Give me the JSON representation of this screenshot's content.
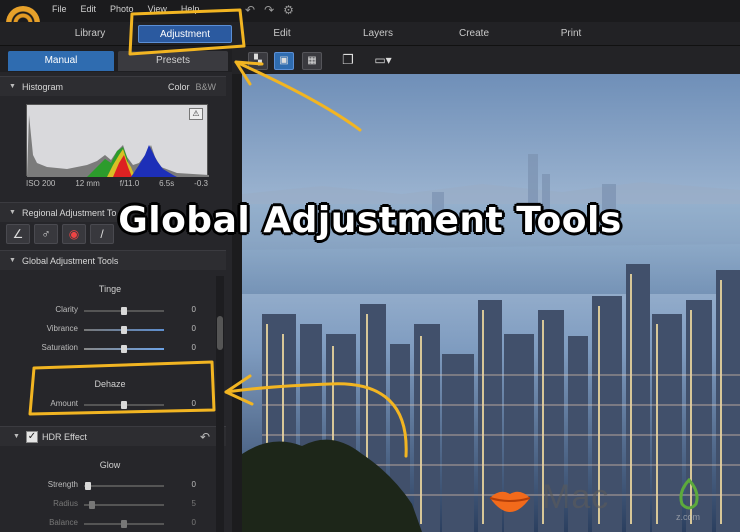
{
  "menu": [
    "File",
    "Edit",
    "Photo",
    "View",
    "Help"
  ],
  "modes": {
    "library": "Library",
    "adjustment": "Adjustment",
    "edit": "Edit",
    "layers": "Layers",
    "create": "Create",
    "print": "Print"
  },
  "panel_tabs": {
    "manual": "Manual",
    "presets": "Presets"
  },
  "histogram": {
    "title": "Histogram",
    "color": "Color",
    "bw": "B&W",
    "info": [
      "ISO 200",
      "12 mm",
      "f/11.0",
      "6.5s",
      "-0.3"
    ]
  },
  "regional": {
    "title": "Regional Adjustment To"
  },
  "global": {
    "title": "Global Adjustment Tools",
    "tinge": {
      "label": "Tinge",
      "rows": [
        {
          "label": "Clarity",
          "value": "0",
          "level": 0.5
        },
        {
          "label": "Vibrance",
          "value": "0",
          "level": 0.5
        },
        {
          "label": "Saturation",
          "value": "0",
          "level": 0.5
        }
      ]
    },
    "dehaze": {
      "label": "Dehaze",
      "rows": [
        {
          "label": "Amount",
          "value": "0",
          "level": 0.5
        }
      ]
    }
  },
  "hdr": {
    "title": "HDR Effect",
    "glow": {
      "label": "Glow",
      "rows": [
        {
          "label": "Strength",
          "value": "0",
          "level": 0.05
        },
        {
          "label": "Radius",
          "value": "5",
          "level": 0.1
        },
        {
          "label": "Balance",
          "value": "0",
          "level": 0.5
        }
      ]
    }
  },
  "headline": "Global Adjustment Tools",
  "watermark": {
    "text": "Mac",
    "sub": "z.com"
  },
  "colors": {
    "accent": "#2f6cb0",
    "annotation": "#f2b522",
    "watermark_orange": "#f26a1b",
    "watermark_green": "#5caa3c"
  }
}
